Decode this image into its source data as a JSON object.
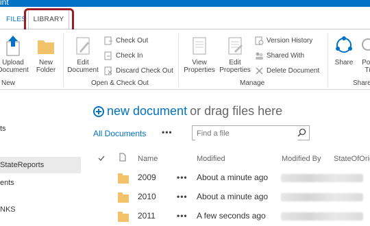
{
  "app": {
    "title_fragment": "int"
  },
  "tabs": {
    "files": "FILES",
    "library": "LIBRARY"
  },
  "ribbon": {
    "new_group": {
      "upload": [
        "Upload",
        "Document"
      ],
      "new_folder": [
        "New",
        "Folder"
      ],
      "label": "New"
    },
    "open_checkout_group": {
      "edit_document": [
        "Edit",
        "Document"
      ],
      "check_out": "Check Out",
      "check_in": "Check In",
      "discard_check_out": "Discard Check Out",
      "label": "Open & Check Out"
    },
    "manage_group": {
      "view_properties": [
        "View",
        "Properties"
      ],
      "edit_properties": [
        "Edit",
        "Properties"
      ],
      "version_history": "Version History",
      "shared_with": "Shared With",
      "delete_document": "Delete Document",
      "label": "Manage"
    },
    "share_group": {
      "share": "Share",
      "popularity": [
        "Pop",
        "Tr"
      ],
      "label": "Share"
    }
  },
  "left_nav": [
    {
      "label": "ts",
      "selected": false
    },
    {
      "label": "StateReports",
      "selected": true
    },
    {
      "label": "ents",
      "selected": false
    },
    {
      "label": "NKS",
      "selected": false
    }
  ],
  "main": {
    "new_document": "new document",
    "drag_text": "or drag files here",
    "view_name": "All Documents",
    "search_placeholder": "Find a file"
  },
  "columns": {
    "name": "Name",
    "modified": "Modified",
    "modified_by": "Modified By",
    "state": "StateOfOrig"
  },
  "rows": [
    {
      "name": "2009",
      "modified": "About a minute ago"
    },
    {
      "name": "2010",
      "modified": "About a minute ago"
    },
    {
      "name": "2011",
      "modified": "A few seconds ago"
    }
  ],
  "colors": {
    "accent": "#0072c6",
    "highlight": "#9b1c24",
    "folder": "#f2c26b"
  }
}
